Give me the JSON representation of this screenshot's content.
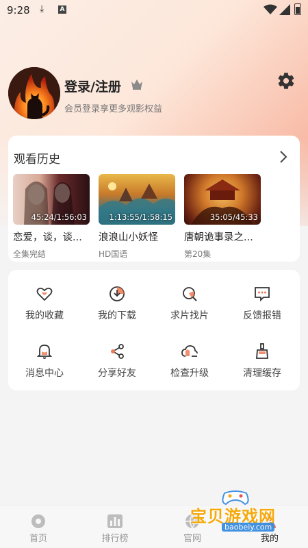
{
  "status_bar": {
    "time": "9:28"
  },
  "profile": {
    "login_label": "登录/注册",
    "subtitle": "会员登录享更多观影权益"
  },
  "history": {
    "title": "观看历史",
    "items": [
      {
        "time": "45:24/1:56:03",
        "name": "恋爱，谈，谈...",
        "sub": "全集完结"
      },
      {
        "time": "1:13:55/1:58:15",
        "name": "浪浪山小妖怪",
        "sub": "HD国语"
      },
      {
        "time": "35:05/45:33",
        "name": "唐朝诡事录之...",
        "sub": "第20集"
      }
    ]
  },
  "menu": {
    "items": [
      {
        "label": "我的收藏",
        "icon": "heart-icon"
      },
      {
        "label": "我的下载",
        "icon": "download-icon"
      },
      {
        "label": "求片找片",
        "icon": "search-film-icon"
      },
      {
        "label": "反馈报错",
        "icon": "feedback-icon"
      },
      {
        "label": "消息中心",
        "icon": "bell-icon"
      },
      {
        "label": "分享好友",
        "icon": "share-icon"
      },
      {
        "label": "检查升级",
        "icon": "cloud-upgrade-icon"
      },
      {
        "label": "清理缓存",
        "icon": "broom-icon"
      }
    ]
  },
  "nav": {
    "tabs": [
      {
        "label": "首页",
        "icon": "home-icon"
      },
      {
        "label": "排行榜",
        "icon": "ranking-icon"
      },
      {
        "label": "官网",
        "icon": "website-icon"
      },
      {
        "label": "我的",
        "icon": "profile-icon",
        "active": true
      }
    ]
  },
  "watermark": {
    "text": "宝贝游戏网",
    "url": "baobeiy.com"
  },
  "colors": {
    "accent": "#f07a56",
    "icon_stroke": "#333333",
    "gradient_end": "#f6a890"
  }
}
